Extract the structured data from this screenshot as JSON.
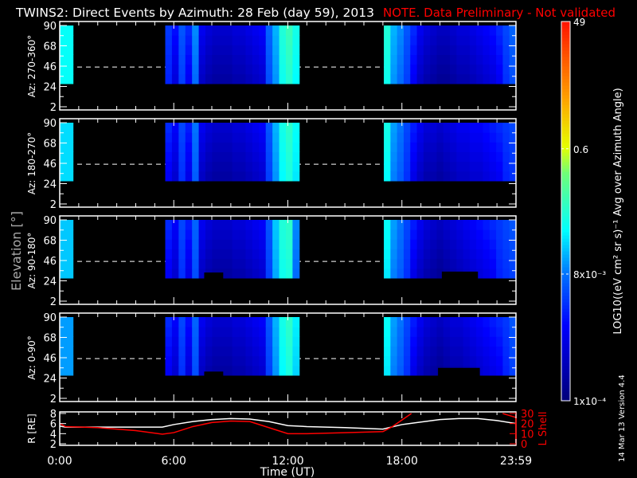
{
  "title": "TWINS2: Direct Events by Azimuth: 28 Feb (day  59), 2013",
  "note": "NOTE. Data Preliminary - Not validated",
  "ylabel_common": "Elevation [°]",
  "side_text": "14 Mar 13   Version 4.4",
  "colorbar": {
    "label": "LOG10((eV cm² sr s)⁻¹ Avg over Azimuth Angle)",
    "ticks": [
      {
        "label": "49",
        "log": 1.69
      },
      {
        "label": "0.6",
        "log": -0.22
      },
      {
        "label": "8x10⁻³",
        "log": -2.1
      },
      {
        "label": "1x10⁻⁴",
        "log": -4
      }
    ],
    "range_log": [
      -4,
      1.69
    ]
  },
  "chart_data": [
    {
      "type": "heatmap",
      "xlabel": "Time (UT)",
      "x_ticks": [
        "0:00",
        "6:00",
        "12:00",
        "18:00",
        "23:59"
      ],
      "xlim_hours": [
        0,
        24
      ],
      "y_ticks": [
        "90",
        "68",
        "46",
        "24",
        "2"
      ],
      "ylim": [
        -4,
        90
      ],
      "data_elev_range": [
        27,
        90
      ],
      "dashed_elevation": 45,
      "blocks_hours": [
        [
          0,
          0.7
        ],
        [
          5.55,
          12.6
        ],
        [
          17.05,
          24
        ]
      ],
      "panels": [
        {
          "name": "Az: 270-360°",
          "columns_log": [
            [
              -1.4,
              -1.4
            ],
            [
              -2.5,
              -2.8,
              -2.3,
              -2.6,
              -2.0,
              -3.0,
              -3.2,
              -3.3,
              -3.3,
              -3.3,
              -3.2,
              -3.2,
              -3.1,
              -3.0,
              -2.9,
              -2.2,
              -1.8,
              -1.2,
              -1.0,
              -1.3
            ],
            [
              -1.2,
              -1.8,
              -2.0,
              -2.3,
              -2.6,
              -3.0,
              -3.2,
              -3.3,
              -3.4,
              -3.4,
              -3.3,
              -3.2,
              -3.2,
              -3.1,
              -3.0,
              -2.9,
              -2.8,
              -2.6,
              -2.4,
              -2.2
            ]
          ],
          "gaps": []
        },
        {
          "name": "Az: 180-270°",
          "columns_log": [
            [
              -1.6,
              -1.6
            ],
            [
              -2.6,
              -2.9,
              -2.4,
              -2.7,
              -2.1,
              -3.0,
              -3.2,
              -3.3,
              -3.3,
              -3.3,
              -3.2,
              -3.2,
              -3.1,
              -3.0,
              -2.9,
              -2.3,
              -1.8,
              -1.3,
              -1.1,
              -1.4
            ],
            [
              -1.3,
              -1.9,
              -2.1,
              -2.4,
              -2.7,
              -3.0,
              -3.2,
              -3.2,
              -3.3,
              -3.2,
              -3.1,
              -3.0,
              -3.0,
              -2.9,
              -2.9,
              -2.8,
              -2.7,
              -2.6,
              -2.5,
              -2.4
            ]
          ],
          "gaps": []
        },
        {
          "name": "Az: 90-180°",
          "columns_log": [
            [
              -1.7,
              -1.7
            ],
            [
              -2.6,
              -2.9,
              -2.4,
              -2.7,
              -2.2,
              -3.0,
              -3.2,
              -3.3,
              -3.3,
              -3.3,
              -3.2,
              -3.2,
              -3.1,
              -3.0,
              -2.9,
              -2.3,
              -1.7,
              -1.2,
              -1.1,
              -2.0
            ],
            [
              -1.4,
              -1.9,
              -2.1,
              -2.4,
              -2.7,
              -3.0,
              -3.2,
              -3.3,
              -3.4,
              -3.3,
              -3.2,
              -3.1,
              -3.0,
              -2.9,
              -2.8,
              -2.7,
              -2.6,
              -2.5,
              -2.4,
              -2.3
            ]
          ],
          "gaps": [
            [
              7.6,
              8.6,
              33
            ],
            [
              20.1,
              22.0,
              34
            ]
          ]
        },
        {
          "name": "Az: 0-90°",
          "columns_log": [
            [
              -1.9,
              -1.9
            ],
            [
              -2.6,
              -2.9,
              -2.4,
              -2.8,
              -2.2,
              -3.0,
              -3.2,
              -3.3,
              -3.3,
              -3.3,
              -3.2,
              -3.2,
              -3.1,
              -3.0,
              -2.9,
              -2.3,
              -1.8,
              -1.3,
              -1.1,
              -1.5
            ],
            [
              -1.4,
              -1.9,
              -2.1,
              -2.4,
              -2.7,
              -3.0,
              -3.2,
              -3.3,
              -3.4,
              -3.3,
              -3.2,
              -3.2,
              -3.1,
              -3.0,
              -2.9,
              -2.8,
              -2.7,
              -2.6,
              -2.5,
              -2.3
            ]
          ],
          "gaps": [
            [
              7.6,
              8.6,
              31
            ],
            [
              19.9,
              22.1,
              35
            ]
          ]
        }
      ]
    },
    {
      "type": "line",
      "xlabel": "Time (UT)",
      "ylabel": "R [RE]",
      "ylabel_right": "L Shell",
      "ylim": [
        2,
        8
      ],
      "ylim_right": [
        0,
        30
      ],
      "y_ticks": [
        "8",
        "6",
        "4",
        "2"
      ],
      "y_ticks_right": [
        "30",
        "20",
        "10",
        "0"
      ],
      "series": [
        {
          "name": "R",
          "color": "#ffffff",
          "x": [
            0,
            0.3,
            2,
            5.4,
            6,
            7,
            8,
            9,
            10,
            11,
            12,
            13,
            15,
            17,
            18,
            19,
            20,
            21,
            22,
            23,
            24
          ],
          "y": [
            5.5,
            5.3,
            5.3,
            5.3,
            5.8,
            6.4,
            6.8,
            7.0,
            6.9,
            6.4,
            5.6,
            5.4,
            5.2,
            4.9,
            5.8,
            6.3,
            6.8,
            7.0,
            7.0,
            6.6,
            6.0
          ]
        },
        {
          "name": "L Shell",
          "color": "#ff0000",
          "x": [
            0,
            0.3,
            2,
            4,
            5.4,
            6,
            7,
            8,
            9,
            10,
            11,
            12,
            13,
            15,
            17,
            17.5,
            18.5
          ],
          "y": [
            20,
            17,
            16,
            13,
            9.5,
            11,
            17,
            21,
            22.5,
            22,
            16,
            10,
            10,
            11,
            12,
            17,
            30
          ]
        },
        {
          "name": "L Shell (end)",
          "color": "#ff0000",
          "x": [
            23.3,
            24
          ],
          "y": [
            30,
            26
          ]
        }
      ]
    }
  ]
}
